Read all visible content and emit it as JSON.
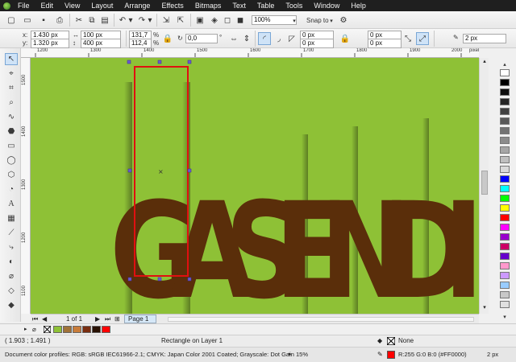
{
  "menu": [
    "File",
    "Edit",
    "View",
    "Layout",
    "Arrange",
    "Effects",
    "Bitmaps",
    "Text",
    "Table",
    "Tools",
    "Window",
    "Help"
  ],
  "toolbar": {
    "zoom": "100%",
    "snap_to": "Snap to"
  },
  "property_bar": {
    "x": "1.430 px",
    "y": "1.320 px",
    "width": "100 px",
    "height": "400 px",
    "scale_x": "131,7",
    "scale_y": "112,4",
    "scale_unit": "%",
    "rotation": "0,0",
    "corner_tl": "0 px",
    "corner_bl": "0 px",
    "corner_tr": "0 px",
    "corner_br": "0 px",
    "outline_width": "2 px"
  },
  "rulers": {
    "horizontal": [
      "1200",
      "1300",
      "1400",
      "1500",
      "1600",
      "1700",
      "1800",
      "1900",
      "2000",
      "pixels"
    ],
    "vertical": [
      "1500",
      "1400",
      "1300",
      "1200",
      "1100"
    ]
  },
  "canvas": {
    "text": "GASENDI",
    "background": "#8ec136",
    "text_color": "#5a2e0a",
    "selection_color": "#e01010"
  },
  "page_nav": {
    "page_count": "1 of 1",
    "tab": "Page 1"
  },
  "document_palette": [
    "#8ec136",
    "#a07238",
    "#c87c3a",
    "#7a2e10",
    "#2a1204",
    "#ff0000"
  ],
  "color_palette": [
    "#ffffff",
    "#000000",
    "#0d0d0d",
    "#262626",
    "#404040",
    "#595959",
    "#737373",
    "#8c8c8c",
    "#a6a6a6",
    "#bfbfbf",
    "#d9d9d9",
    "#0000ff",
    "#00ffff",
    "#00ff00",
    "#ffff00",
    "#ff0000",
    "#ff00ff",
    "#9900cc",
    "#cc0066",
    "#6600cc",
    "#ff99cc",
    "#cc99ff",
    "#99ccff",
    "#c8c8c8",
    "#e0e0e0"
  ],
  "status": {
    "cursor": "( 1.903 ; 1.491 )",
    "selection": "Rectangle on Layer 1",
    "fill": "None",
    "profiles": "Document color profiles: RGB: sRGB IEC61966-2.1; CMYK: Japan Color 2001 Coated; Grayscale: Dot Gain 15%",
    "outline_color": "R:255 G:0 B:0 (#FF0000)",
    "outline_width": "2 px"
  }
}
